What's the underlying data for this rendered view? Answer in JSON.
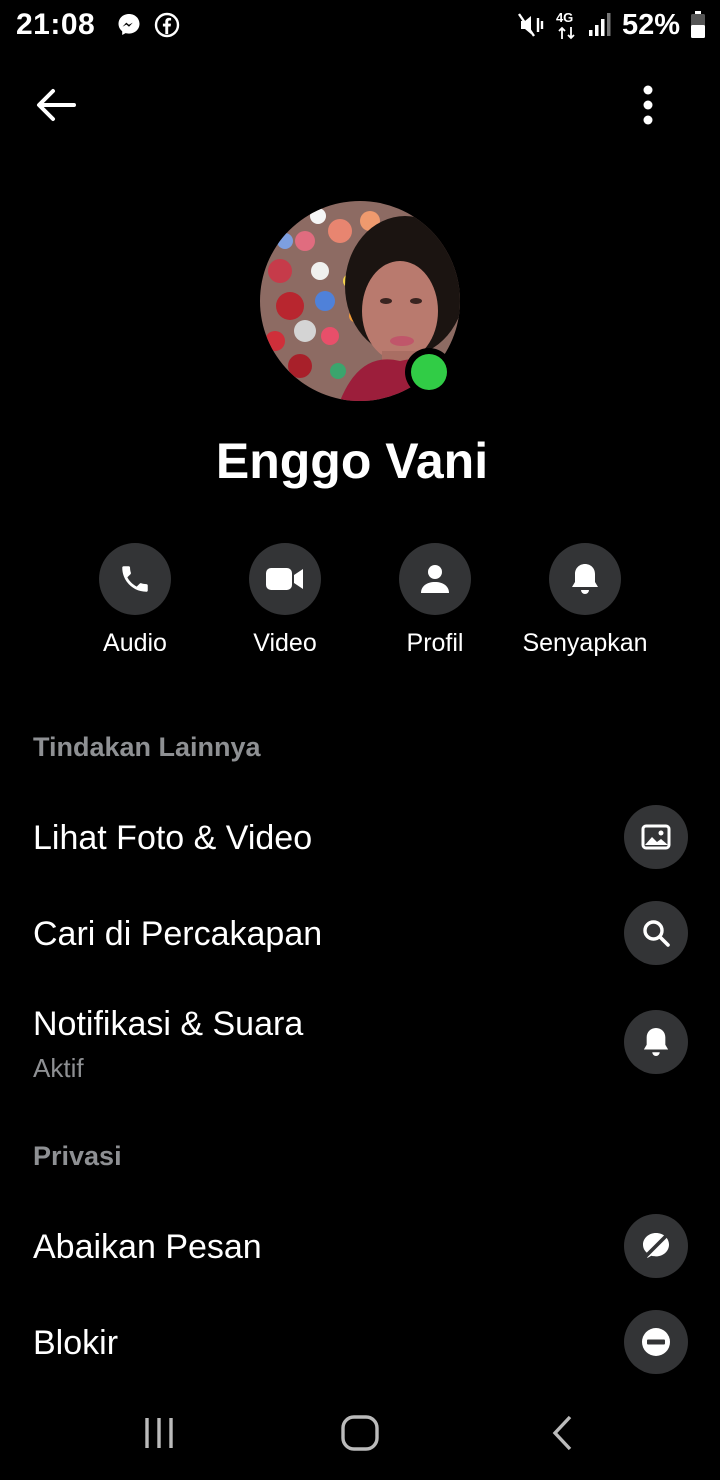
{
  "status_bar": {
    "time": "21:08",
    "app_icons": [
      "messenger-icon",
      "facebook-icon"
    ],
    "network": "4G",
    "battery_percent": "52%"
  },
  "header": {
    "back_icon": "arrow-left-icon",
    "more_icon": "more-vertical-icon"
  },
  "profile": {
    "name": "Enggo Vani",
    "online": true,
    "online_color": "#31cc46"
  },
  "quick_actions": [
    {
      "label": "Audio",
      "icon": "phone-icon"
    },
    {
      "label": "Video",
      "icon": "video-camera-icon"
    },
    {
      "label": "Profil",
      "icon": "person-icon"
    },
    {
      "label": "Senyapkan",
      "icon": "bell-icon"
    }
  ],
  "sections": {
    "more_actions": {
      "title": "Tindakan Lainnya",
      "items": [
        {
          "label": "Lihat Foto & Video",
          "icon": "image-icon"
        },
        {
          "label": "Cari di Percakapan",
          "icon": "search-icon"
        },
        {
          "label": "Notifikasi & Suara",
          "sublabel": "Aktif",
          "icon": "bell-icon"
        }
      ]
    },
    "privacy": {
      "title": "Privasi",
      "items": [
        {
          "label": "Abaikan Pesan",
          "icon": "ignore-icon"
        },
        {
          "label": "Blokir",
          "icon": "block-icon"
        }
      ]
    }
  },
  "colors": {
    "background": "#000000",
    "button_bg": "#333436",
    "secondary_text": "#8e9093",
    "online": "#31cc46"
  }
}
